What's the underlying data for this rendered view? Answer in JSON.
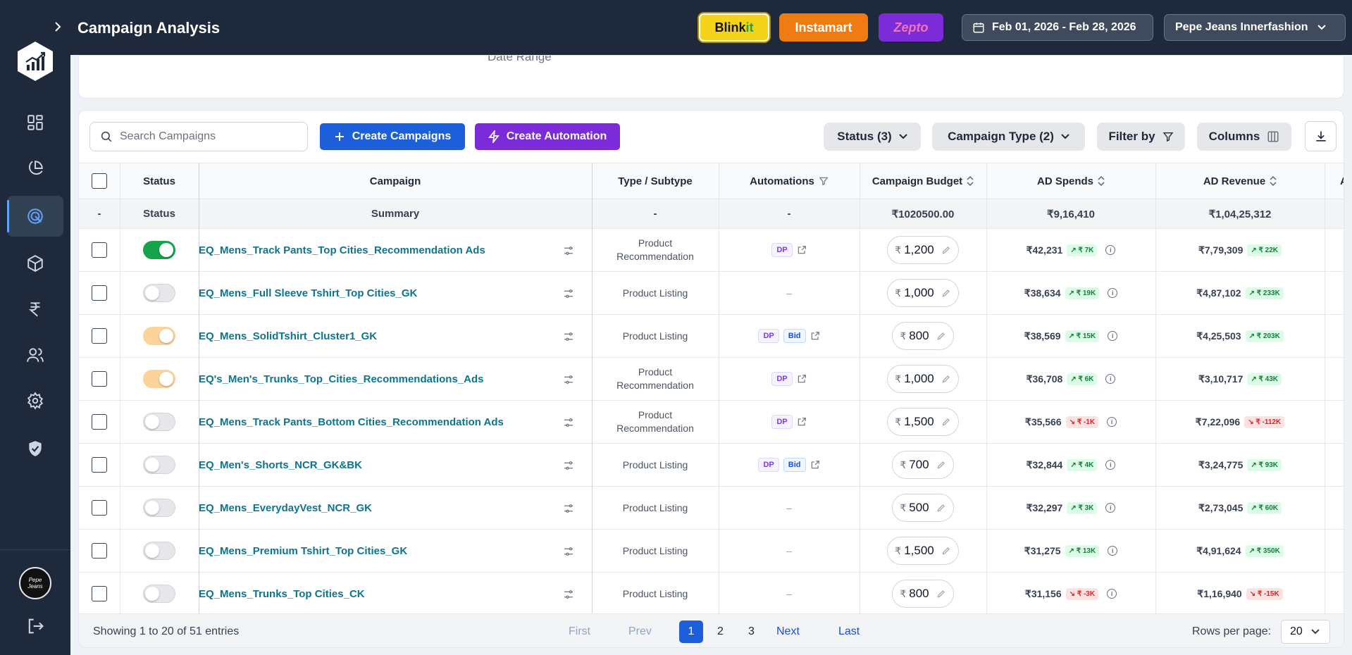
{
  "header": {
    "title": "Campaign Analysis",
    "platforms": [
      {
        "label_a": "Blink",
        "label_b": "it"
      },
      {
        "label": "Instamart"
      },
      {
        "label": "Zepto"
      }
    ],
    "date_range": "Feb 01, 2026 - Feb 28, 2026",
    "brand": "Pepe Jeans Innerfashion"
  },
  "sidebar": {
    "icons": [
      "dashboard-icon",
      "pie-chart-icon",
      "target-icon",
      "cube-icon",
      "rupee-icon",
      "users-icon",
      "gear-icon",
      "shield-check-icon"
    ],
    "active_index": 2,
    "avatar_text": "Pepe Jeans"
  },
  "top_card": {
    "label": "Date Range"
  },
  "toolbar": {
    "search_placeholder": "Search Campaigns",
    "create_campaigns": "Create Campaigns",
    "create_automation": "Create Automation",
    "status_filter": "Status (3)",
    "campaign_type_filter": "Campaign Type (2)",
    "filter_by": "Filter by",
    "columns": "Columns"
  },
  "table": {
    "headers": {
      "status": "Status",
      "campaign": "Campaign",
      "type": "Type / Subtype",
      "automations": "Automations",
      "budget": "Campaign Budget",
      "ad_spends": "AD Spends",
      "ad_revenue": "AD Revenue",
      "next": "A"
    },
    "summary": {
      "checkbox": "-",
      "status": "Status",
      "campaign": "Summary",
      "type": "-",
      "automations": "-",
      "budget": "₹1020500.00",
      "ad_spends": "₹9,16,410",
      "ad_revenue": "₹1,04,25,312"
    },
    "rows": [
      {
        "status": "on",
        "name": "EQ_Mens_Track Pants_Top Cities_Recommendation Ads",
        "type1": "Product",
        "type2": "Recommendation",
        "tags": [
          "DP"
        ],
        "budget": "1,200",
        "spend": "₹42,231",
        "spend_delta": "₹ 7K",
        "spend_dir": "up",
        "rev": "₹7,79,309",
        "rev_delta": "₹ 22K",
        "rev_dir": "up"
      },
      {
        "status": "off",
        "name": "EQ_Mens_Full Sleeve Tshirt_Top Cities_GK",
        "type1": "Product Listing",
        "type2": "",
        "tags": [],
        "budget": "1,000",
        "spend": "₹38,634",
        "spend_delta": "₹ 19K",
        "spend_dir": "up",
        "rev": "₹4,87,102",
        "rev_delta": "₹ 233K",
        "rev_dir": "up"
      },
      {
        "status": "pending",
        "name": "EQ_Mens_SolidTshirt_Cluster1_GK",
        "type1": "Product Listing",
        "type2": "",
        "tags": [
          "DP",
          "Bid"
        ],
        "budget": "800",
        "spend": "₹38,569",
        "spend_delta": "₹ 15K",
        "spend_dir": "up",
        "rev": "₹4,25,503",
        "rev_delta": "₹ 203K",
        "rev_dir": "up"
      },
      {
        "status": "pending",
        "name": "EQ's_Men's_Trunks_Top_Cities_Recommendations_Ads",
        "type1": "Product",
        "type2": "Recommendation",
        "tags": [
          "DP"
        ],
        "budget": "1,000",
        "spend": "₹36,708",
        "spend_delta": "₹ 6K",
        "spend_dir": "up",
        "rev": "₹3,10,717",
        "rev_delta": "₹ 43K",
        "rev_dir": "up"
      },
      {
        "status": "off",
        "name": "EQ_Mens_Track Pants_Bottom Cities_Recommendation Ads",
        "type1": "Product",
        "type2": "Recommendation",
        "tags": [
          "DP"
        ],
        "budget": "1,500",
        "spend": "₹35,566",
        "spend_delta": "₹ -1K",
        "spend_dir": "down",
        "rev": "₹7,22,096",
        "rev_delta": "₹ -112K",
        "rev_dir": "down"
      },
      {
        "status": "off",
        "name": "EQ_Men's_Shorts_NCR_GK&BK",
        "type1": "Product Listing",
        "type2": "",
        "tags": [
          "DP",
          "Bid"
        ],
        "budget": "700",
        "spend": "₹32,844",
        "spend_delta": "₹ 4K",
        "spend_dir": "up",
        "rev": "₹3,24,775",
        "rev_delta": "₹ 93K",
        "rev_dir": "up"
      },
      {
        "status": "off",
        "name": "EQ_Mens_EverydayVest_NCR_GK",
        "type1": "Product Listing",
        "type2": "",
        "tags": [],
        "budget": "500",
        "spend": "₹32,297",
        "spend_delta": "₹ 3K",
        "spend_dir": "up",
        "rev": "₹2,73,045",
        "rev_delta": "₹ 60K",
        "rev_dir": "up"
      },
      {
        "status": "off",
        "name": "EQ_Mens_Premium Tshirt_Top Cities_GK",
        "type1": "Product Listing",
        "type2": "",
        "tags": [],
        "budget": "1,500",
        "spend": "₹31,275",
        "spend_delta": "₹ 13K",
        "spend_dir": "up",
        "rev": "₹4,91,624",
        "rev_delta": "₹ 350K",
        "rev_dir": "up"
      },
      {
        "status": "off",
        "name": "EQ_Mens_Trunks_Top Cities_CK",
        "type1": "Product Listing",
        "type2": "",
        "tags": [],
        "budget": "800",
        "spend": "₹31,156",
        "spend_delta": "₹ -3K",
        "spend_dir": "down",
        "rev": "₹1,16,940",
        "rev_delta": "₹ -15K",
        "rev_dir": "down"
      }
    ]
  },
  "footer": {
    "showing": "Showing 1 to 20 of 51 entries",
    "first": "First",
    "prev": "Prev",
    "pages": [
      "1",
      "2",
      "3"
    ],
    "next": "Next",
    "last": "Last",
    "rows_per_page_label": "Rows per page:",
    "rows_per_page": "20"
  },
  "colors": {
    "sidebar": "#1e293b",
    "primary": "#1d5fdb",
    "automation": "#7c2bd9",
    "blinkit": "#f6d31b",
    "instamart": "#f07b12",
    "zepto": "#7c2bd9",
    "toggle_on": "#16a34a",
    "toggle_pending": "#fcd39b"
  }
}
